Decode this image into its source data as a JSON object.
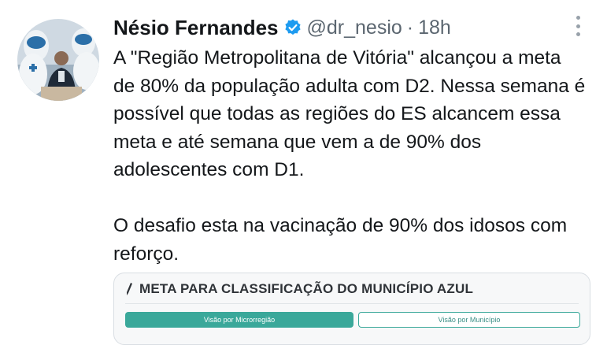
{
  "tweet": {
    "author_name": "Nésio Fernandes",
    "handle": "@dr_nesio",
    "separator": "·",
    "time": "18h",
    "paragraph_1": "A \"Região Metropolitana de Vitória\" alcançou a meta de 80% da população adulta com D2. Nessa semana é possível que todas as regiões do ES alcancem essa meta e até semana que vem a de 90% dos adolescentes com D1.",
    "paragraph_2": "O desafio esta na vacinação de 90% dos idosos com reforço."
  },
  "media": {
    "title": "META PARA CLASSIFICAÇÃO DO MUNICÍPIO AZUL",
    "button_1": "Visão por Microrregião",
    "button_2": "Visão por Município"
  },
  "colors": {
    "verified": "#1d9bf0",
    "teal": "#3aa89a",
    "text": "#14171a",
    "muted": "#5b6670"
  },
  "icons": {
    "verified": "verified-badge-icon",
    "more": "more-options-icon",
    "pen": "pen-icon"
  }
}
